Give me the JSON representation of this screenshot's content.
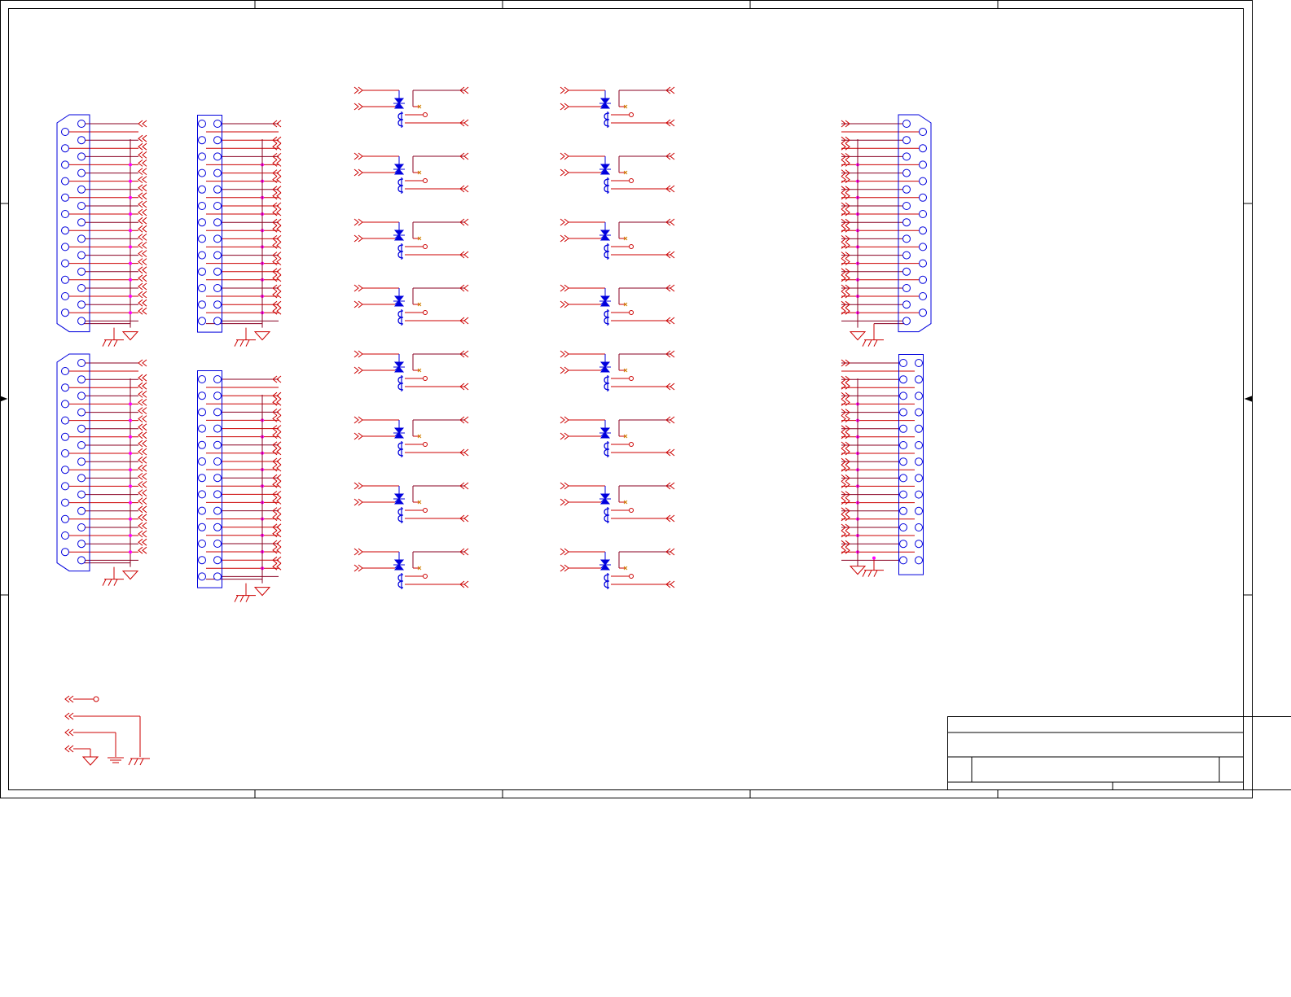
{
  "sheet": {
    "footer_text": "",
    "colors": {
      "frame": "#000000",
      "wire": "#cc0000",
      "part": "#0000dd",
      "wire_dark": "#880022",
      "junction": "#ff00ff",
      "noconnect": "#d08000"
    }
  },
  "symbols": [
    "db25-connector",
    "idc-header",
    "relay",
    "port-connector",
    "ground",
    "chassis-ground",
    "earth-ground",
    "no-connect",
    "title-block"
  ]
}
